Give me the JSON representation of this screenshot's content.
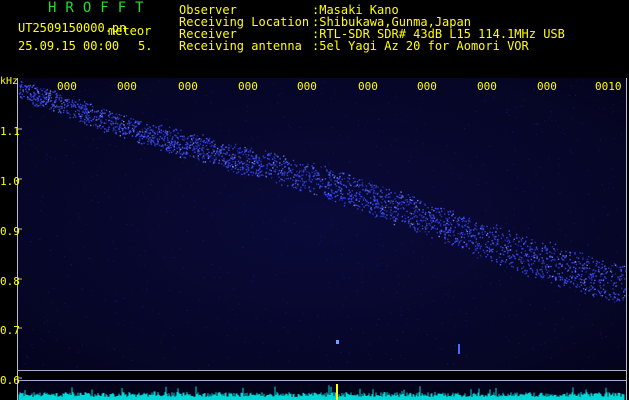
{
  "header": {
    "app_title": "HROFFT",
    "filename": "UT2509150000.pn",
    "meteor_label": "meteor",
    "datetime": "25.09.15 00:00",
    "count": "5.",
    "fields": [
      {
        "label": "Observer",
        "value": ":Masaki Kano"
      },
      {
        "label": "Receiving Location",
        "value": ":Shibukawa,Gunma,Japan"
      },
      {
        "label": "Receiver",
        "value": ":RTL-SDR SDR# 43dB L15 114.1MHz USB"
      },
      {
        "label": "Receiving antenna",
        "value": ":5el Yagi Az 20 for Aomori VOR"
      }
    ]
  },
  "axis": {
    "y_unit": "kHz",
    "y_ticks": [
      "1.1",
      "1.0",
      "0.9",
      "0.8",
      "0.7",
      "0.6"
    ],
    "x_ticks": [
      "000",
      "000",
      "000",
      "000",
      "000",
      "000",
      "000",
      "000",
      "000",
      "0010"
    ]
  },
  "colors": {
    "text": "#ffff00",
    "title": "#22dd22",
    "signal": "#3a4cff",
    "background": "#060628",
    "strip": "#00d8d8"
  }
}
